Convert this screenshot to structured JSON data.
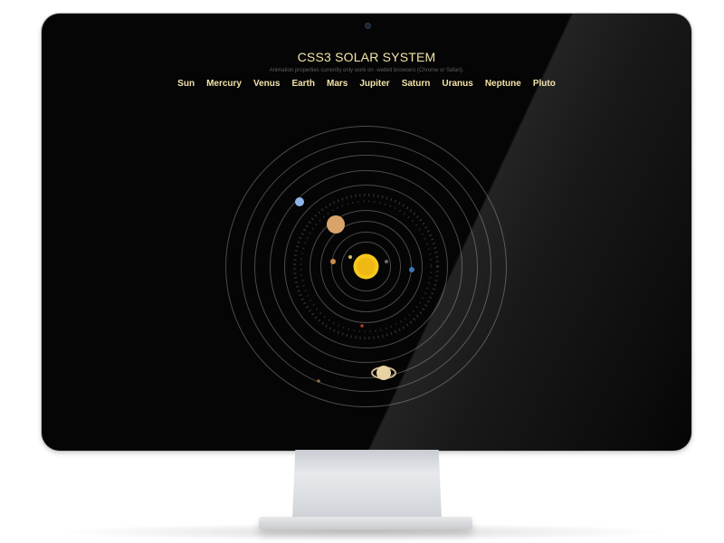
{
  "screen": {
    "title": "CSS3 SOLAR SYSTEM",
    "subtitle": "Animation properties currently only work on -webkit browsers (Chrome or Safari)."
  },
  "nav": {
    "items": [
      "Sun",
      "Mercury",
      "Venus",
      "Earth",
      "Mars",
      "Jupiter",
      "Saturn",
      "Uranus",
      "Neptune",
      "Pluto"
    ]
  },
  "colors": {
    "nav_text": "#f3e2a8",
    "title_text": "#f2e4a7",
    "screen_bg": "#050505",
    "sun": "#f2c21a"
  }
}
